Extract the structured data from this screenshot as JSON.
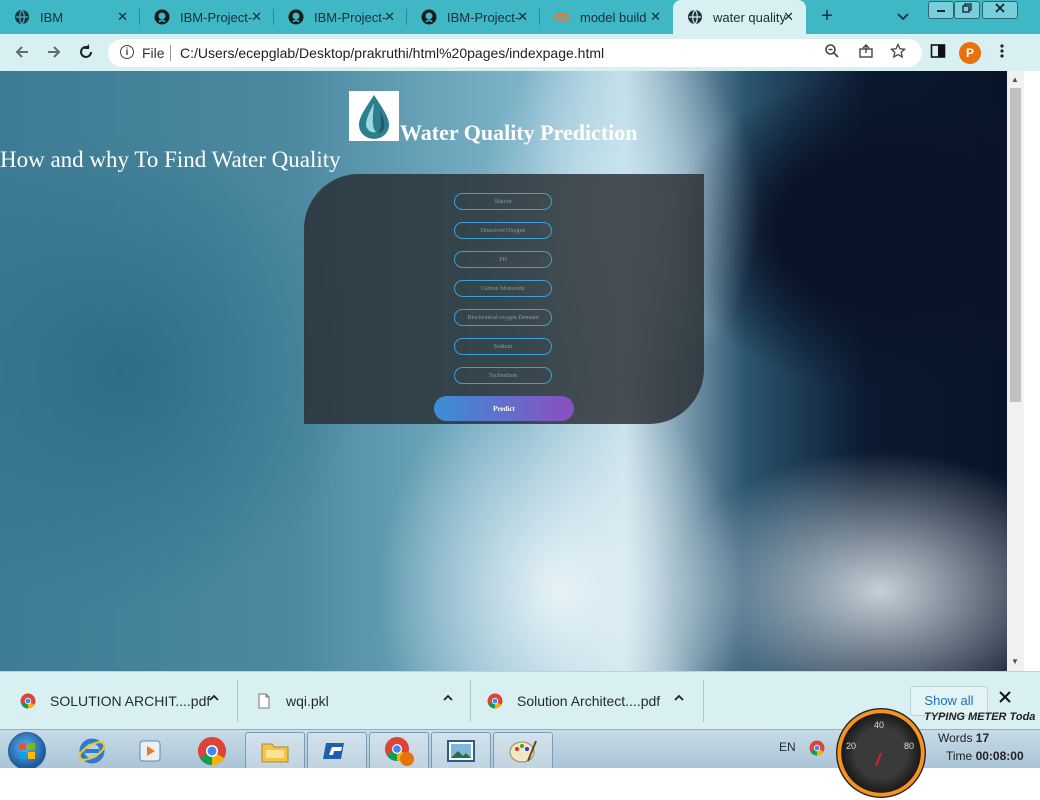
{
  "browser": {
    "tabs": [
      {
        "title": "IBM",
        "icon": "globe-icon",
        "active": false
      },
      {
        "title": "IBM-Project-",
        "icon": "github-icon",
        "active": false
      },
      {
        "title": "IBM-Project-",
        "icon": "github-icon",
        "active": false
      },
      {
        "title": "IBM-Project-",
        "icon": "github-icon",
        "active": false
      },
      {
        "title": "model build",
        "icon": "jupyter-icon",
        "active": false
      },
      {
        "title": "water quality",
        "icon": "globe-icon",
        "active": true
      }
    ],
    "close_glyph": "✕",
    "new_tab_glyph": "+",
    "address": {
      "scheme_label": "File",
      "url": "C:/Users/ecepglab/Desktop/prakruthi/html%20pages/indexpage.html"
    },
    "profile_initial": "P"
  },
  "page": {
    "title": "Water Quality Prediction",
    "subheading": "How and why To Find Water Quality",
    "form": {
      "fields": [
        {
          "placeholder": "Station"
        },
        {
          "placeholder": "Dissolved Oxygen"
        },
        {
          "placeholder": "PH"
        },
        {
          "placeholder": "Carbon Monoxide"
        },
        {
          "placeholder": "Biochemical oxygen Demand"
        },
        {
          "placeholder": "Sodium"
        },
        {
          "placeholder": "Technetium"
        }
      ],
      "submit_label": "Predict"
    }
  },
  "downloads": {
    "items": [
      {
        "name": "SOLUTION ARCHIT....pdf",
        "icon": "chrome-icon"
      },
      {
        "name": "wqi.pkl",
        "icon": "file-icon"
      },
      {
        "name": "Solution Architect....pdf",
        "icon": "chrome-icon"
      }
    ],
    "show_all_label": "Show all"
  },
  "taskbar": {
    "language": "EN",
    "typing_meter": {
      "title": "TYPING METER Toda",
      "words_label": "Words",
      "words_value": "17",
      "time_label": "Time",
      "time_value": "00:08:00",
      "gauge_labels": [
        "20",
        "40",
        "80"
      ]
    }
  },
  "colors": {
    "tabstrip": "#3fb7c5",
    "toolbar": "#d9f0f2",
    "profile": "#e8710a",
    "button_gradient_start": "#3a8fd6",
    "button_gradient_end": "#8a4fbf",
    "field_border": "#3aa0d8"
  }
}
